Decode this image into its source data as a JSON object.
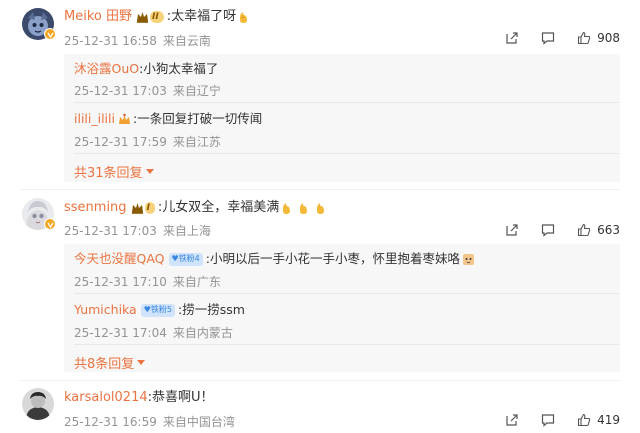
{
  "comments": [
    {
      "username": "Meiko 田野",
      "level": "II",
      "text": ":太幸福了呀",
      "date": "25-12-31 16:58",
      "location": "来自云南",
      "likes": "908",
      "replies": [
        {
          "username": "沐浴露OuO",
          "text": ":小狗太幸福了",
          "date": "25-12-31 17:03",
          "location": "来自辽宁"
        },
        {
          "username": "ilili_ilili",
          "text": ":一条回复打破一切传闻",
          "date": "25-12-31 17:59",
          "location": "来自江苏"
        }
      ],
      "more_label": "共31条回复"
    },
    {
      "username": "ssenming",
      "level": "I",
      "text": ":儿女双全，幸福美满",
      "date": "25-12-31 17:03",
      "location": "来自上海",
      "likes": "663",
      "replies": [
        {
          "username": "今天也没醒QAQ",
          "fan_badge": "铁粉4",
          "text": ":小明以后一手小花一手小枣，怀里抱着枣妹咯",
          "date": "25-12-31 17:10",
          "location": "来自广东"
        },
        {
          "username": "Yumichika",
          "fan_badge": "铁粉5",
          "text": ":捞一捞ssm",
          "date": "25-12-31 17:04",
          "location": "来自内蒙古"
        }
      ],
      "more_label": "共8条回复"
    },
    {
      "username": "karsalol0214",
      "text": ":恭喜啊U！",
      "date": "25-12-31 16:59",
      "location": "来自中国台湾",
      "likes": "419"
    }
  ],
  "colors": {
    "username": "#eb7340",
    "meta": "#939393",
    "reply_bg": "#f7f7f7"
  },
  "icons": {
    "share": "share-icon",
    "comment": "comment-icon",
    "like": "thumbs-up-icon"
  }
}
